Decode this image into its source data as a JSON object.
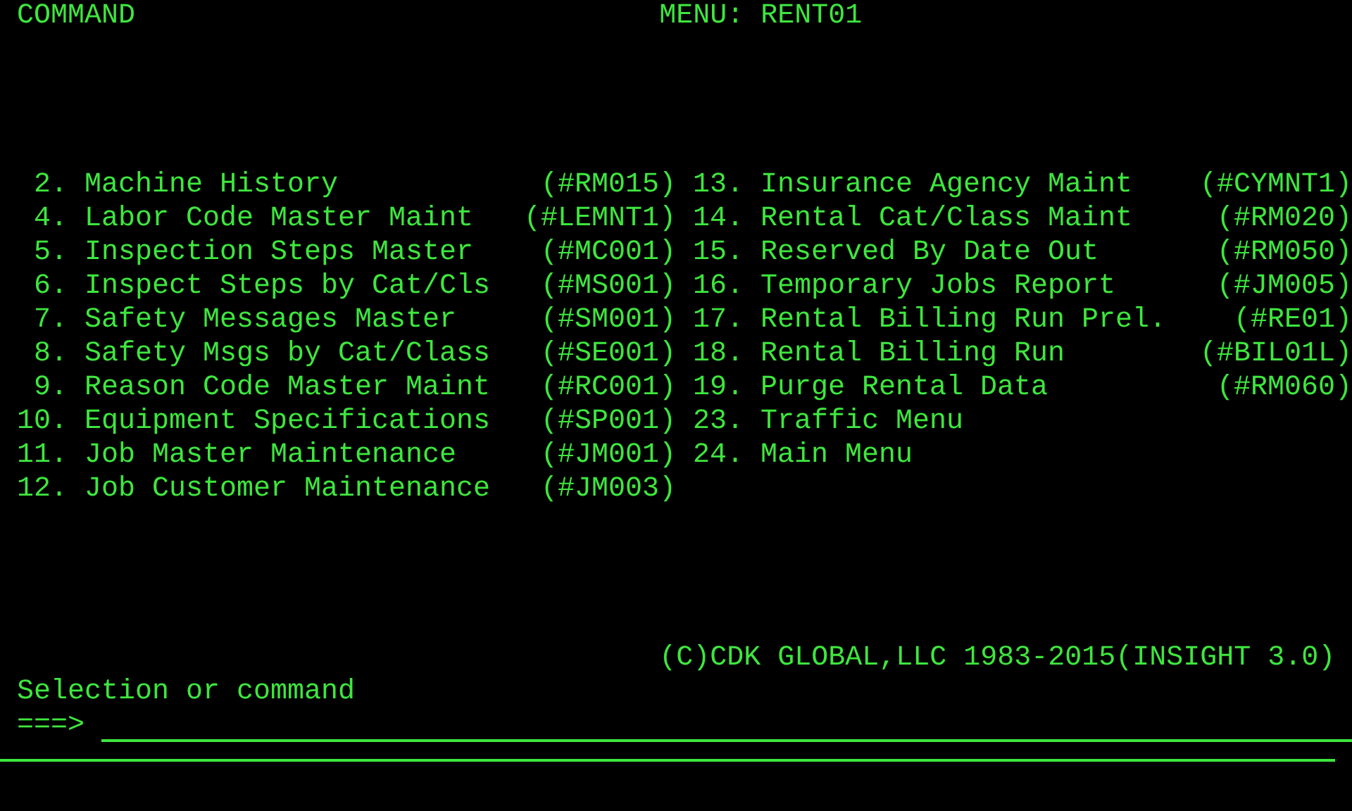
{
  "header": {
    "command_label": "COMMAND",
    "menu_title": "MENU: RENT01"
  },
  "menu": {
    "left": [
      {
        "number": "2.",
        "label": "Machine History",
        "code": "(#RM015)"
      },
      {
        "number": "4.",
        "label": "Labor Code Master Maint",
        "code": "(#LEMNT1)"
      },
      {
        "number": "5.",
        "label": "Inspection Steps Master",
        "code": "(#MC001)"
      },
      {
        "number": "6.",
        "label": "Inspect Steps by Cat/Cls",
        "code": "(#MS001)"
      },
      {
        "number": "7.",
        "label": "Safety Messages Master",
        "code": "(#SM001)"
      },
      {
        "number": "8.",
        "label": "Safety Msgs by Cat/Class",
        "code": "(#SE001)"
      },
      {
        "number": "9.",
        "label": "Reason Code Master Maint",
        "code": "(#RC001)"
      },
      {
        "number": "10.",
        "label": "Equipment Specifications",
        "code": "(#SP001)"
      },
      {
        "number": "11.",
        "label": "Job Master Maintenance",
        "code": "(#JM001)"
      },
      {
        "number": "12.",
        "label": "Job Customer Maintenance",
        "code": "(#JM003)"
      }
    ],
    "right": [
      {
        "number": "13.",
        "label": "Insurance Agency Maint",
        "code": "(#CYMNT1)"
      },
      {
        "number": "14.",
        "label": "Rental Cat/Class Maint",
        "code": "(#RM020)"
      },
      {
        "number": "15.",
        "label": "Reserved By Date Out",
        "code": "(#RM050)"
      },
      {
        "number": "16.",
        "label": "Temporary Jobs Report",
        "code": "(#JM005)"
      },
      {
        "number": "17.",
        "label": "Rental Billing Run Prel.",
        "code": "(#RE01)"
      },
      {
        "number": "18.",
        "label": "Rental Billing Run",
        "code": "(#BIL01L)"
      },
      {
        "number": "19.",
        "label": "Purge Rental Data",
        "code": "(#RM060)"
      },
      {
        "number": "23.",
        "label": "Traffic Menu"
      },
      {
        "number": "24.",
        "label": "Main Menu"
      }
    ]
  },
  "copyright": "(C)CDK GLOBAL,LLC 1983-2015(INSIGHT 3.0)",
  "prompt": "Selection or command",
  "command_input": {
    "prefix": "===>"
  }
}
